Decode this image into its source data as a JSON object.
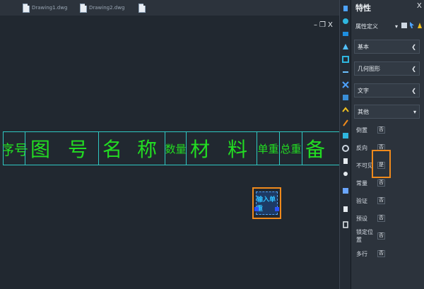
{
  "tabs": [
    {
      "label": "Drawing1.dwg"
    },
    {
      "label": "Drawing2.dwg"
    }
  ],
  "window_controls": {
    "min": "–",
    "restore": "❐",
    "close": "X"
  },
  "table": {
    "cells": [
      "序号",
      "图 号",
      "名 称",
      "数量",
      "材 料",
      "单重",
      "总重",
      "备 注"
    ]
  },
  "selection": {
    "text": "输入单重"
  },
  "panel": {
    "title": "特性",
    "close": "X",
    "type_selector": "属性定义",
    "sections": {
      "basic": "基本",
      "geometry": "几何图形",
      "text": "文字",
      "other": "其他"
    },
    "properties": [
      {
        "name": "倒置",
        "value": "否"
      },
      {
        "name": "反向",
        "value": "否"
      },
      {
        "name": "不可见",
        "value": "是"
      },
      {
        "name": "常量",
        "value": "否"
      },
      {
        "name": "验证",
        "value": "否"
      },
      {
        "name": "预设",
        "value": "否"
      },
      {
        "name": "锁定位置",
        "value": "否"
      },
      {
        "name": "多行",
        "value": "否"
      }
    ]
  },
  "colors": {
    "accent": "#f08a1c",
    "cad_green": "#22dd22",
    "table_line": "#2fc8c3"
  }
}
